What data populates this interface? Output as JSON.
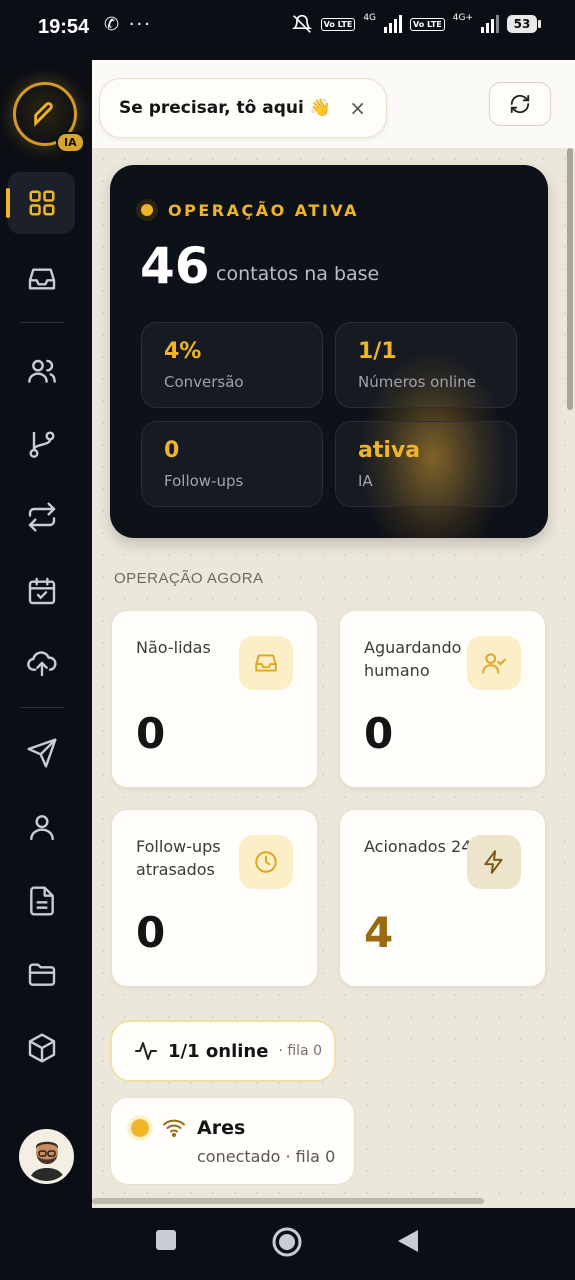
{
  "status_bar": {
    "time": "19:54",
    "left_icons": "✆ ···",
    "network_1": "4G",
    "network_2": "4G+",
    "volte_label": "Vo LTE",
    "battery": "53"
  },
  "sidebar": {
    "brand_badge": "IA",
    "items": [
      {
        "icon": "dashboard-icon",
        "active": true
      },
      {
        "icon": "inbox-icon"
      },
      {
        "icon": "users-icon"
      },
      {
        "icon": "branch-icon"
      },
      {
        "icon": "swap-icon"
      },
      {
        "icon": "calendar-check-icon"
      },
      {
        "icon": "cloud-upload-icon"
      },
      {
        "icon": "send-icon"
      },
      {
        "icon": "user-icon"
      },
      {
        "icon": "document-icon"
      },
      {
        "icon": "folder-icon"
      },
      {
        "icon": "box-icon"
      }
    ]
  },
  "toast": {
    "message": "Se precisar, tô aqui 👋",
    "close": "×"
  },
  "hero": {
    "status": "OPERAÇÃO ATIVA",
    "count": "46",
    "count_label": "contatos na base",
    "metrics": [
      {
        "value": "4%",
        "label": "Conversão"
      },
      {
        "value": "1/1",
        "label": "Números online"
      },
      {
        "value": "0",
        "label": "Follow-ups"
      },
      {
        "value": "ativa",
        "label": "IA"
      }
    ]
  },
  "section": {
    "title": "OPERAÇÃO AGORA"
  },
  "cards": [
    {
      "title": "Não-lidas",
      "value": "0",
      "icon": "inbox-icon"
    },
    {
      "title": "Aguardando humano",
      "value": "0",
      "icon": "user-check-icon"
    },
    {
      "title": "Follow-ups atrasados",
      "value": "0",
      "icon": "clock-icon"
    },
    {
      "title": "Acionados 24h",
      "value": "4",
      "icon": "zap-icon"
    }
  ],
  "online": {
    "main": "1/1 online",
    "sub": "· fila 0"
  },
  "device": {
    "name": "Ares",
    "status": "conectado · fila 0"
  },
  "colors": {
    "accent": "#f0b429",
    "dark": "#0d1118",
    "background": "#ece7db"
  }
}
